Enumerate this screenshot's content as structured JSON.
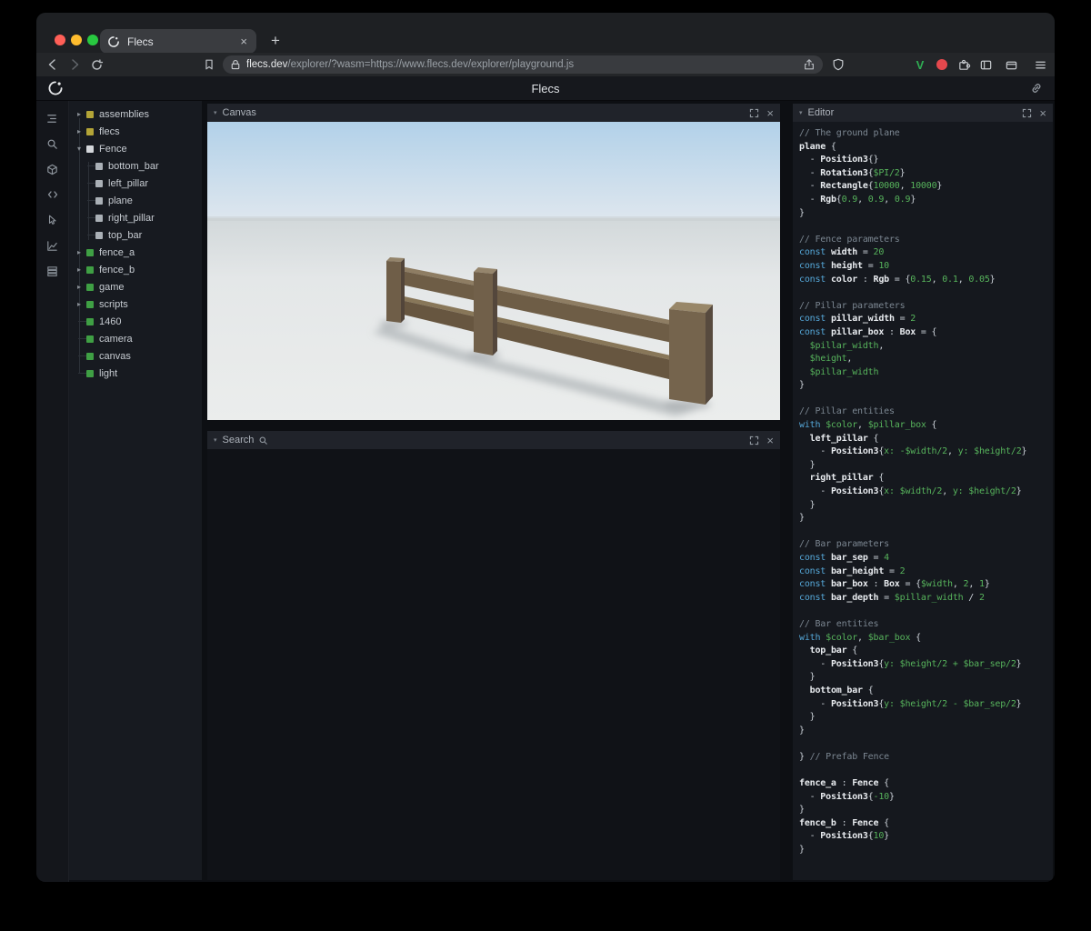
{
  "colors": {
    "module_yellow": "#b3a437",
    "prefab_white": "#d3d6da",
    "child_gray": "#aab0b6",
    "entity_green": "#3f9f44",
    "keyword_blue": "#55a7d8",
    "value_green": "#57b45c",
    "comment_gray": "#7b8691",
    "traffic_red": "#ff5f57",
    "traffic_yellow": "#febc2e",
    "traffic_green": "#28c840"
  },
  "browser": {
    "tab_title": "Flecs",
    "close_glyph": "×",
    "new_tab_glyph": "+",
    "url_host": "flecs.dev",
    "url_rest": "/explorer/?wasm=https://www.flecs.dev/explorer/playground.js"
  },
  "header": {
    "title": "Flecs"
  },
  "sidebar_icons": [
    "outliner-icon",
    "search-icon",
    "cube-icon",
    "code-icon",
    "inspect-icon",
    "chart-icon",
    "memory-icon"
  ],
  "tree": {
    "expanded_glyph": "▾",
    "collapsed_glyph": "▸",
    "items": [
      {
        "label": "assemblies",
        "swatch": "#b3a437",
        "expand": "right",
        "depth": 0
      },
      {
        "label": "flecs",
        "swatch": "#b3a437",
        "expand": "right",
        "depth": 0
      },
      {
        "label": "Fence",
        "swatch": "#d3d6da",
        "expand": "down",
        "depth": 0
      },
      {
        "label": "bottom_bar",
        "swatch": "#aab0b6",
        "expand": null,
        "depth": 1
      },
      {
        "label": "left_pillar",
        "swatch": "#aab0b6",
        "expand": null,
        "depth": 1
      },
      {
        "label": "plane",
        "swatch": "#aab0b6",
        "expand": null,
        "depth": 1
      },
      {
        "label": "right_pillar",
        "swatch": "#aab0b6",
        "expand": null,
        "depth": 1
      },
      {
        "label": "top_bar",
        "swatch": "#aab0b6",
        "expand": null,
        "depth": 1
      },
      {
        "label": "fence_a",
        "swatch": "#3f9f44",
        "expand": "right",
        "depth": 0
      },
      {
        "label": "fence_b",
        "swatch": "#3f9f44",
        "expand": "right",
        "depth": 0
      },
      {
        "label": "game",
        "swatch": "#3f9f44",
        "expand": "right",
        "depth": 0
      },
      {
        "label": "scripts",
        "swatch": "#3f9f44",
        "expand": "right",
        "depth": 0
      },
      {
        "label": "1460",
        "swatch": "#3f9f44",
        "expand": null,
        "depth": 0
      },
      {
        "label": "camera",
        "swatch": "#3f9f44",
        "expand": null,
        "depth": 0
      },
      {
        "label": "canvas",
        "swatch": "#3f9f44",
        "expand": null,
        "depth": 0
      },
      {
        "label": "light",
        "swatch": "#3f9f44",
        "expand": null,
        "depth": 0
      }
    ]
  },
  "panels": {
    "chevron_glyph": "▾",
    "close_glyph": "×",
    "canvas_title": "Canvas",
    "search_title": "Search",
    "editor_title": "Editor"
  },
  "editor": {
    "lines": [
      [
        [
          "c",
          "// The ground plane"
        ]
      ],
      [
        [
          "b",
          "plane"
        ],
        [
          "p",
          " {"
        ]
      ],
      [
        [
          "p",
          "  - "
        ],
        [
          "b",
          "Position3"
        ],
        [
          "p",
          "{}"
        ]
      ],
      [
        [
          "p",
          "  - "
        ],
        [
          "b",
          "Rotation3"
        ],
        [
          "p",
          "{"
        ],
        [
          "g",
          "$PI/2"
        ],
        [
          "p",
          "}"
        ]
      ],
      [
        [
          "p",
          "  - "
        ],
        [
          "b",
          "Rectangle"
        ],
        [
          "p",
          "{"
        ],
        [
          "g",
          "10000"
        ],
        [
          "p",
          ", "
        ],
        [
          "g",
          "10000"
        ],
        [
          "p",
          "}"
        ]
      ],
      [
        [
          "p",
          "  - "
        ],
        [
          "b",
          "Rgb"
        ],
        [
          "p",
          "{"
        ],
        [
          "g",
          "0.9"
        ],
        [
          "p",
          ", "
        ],
        [
          "g",
          "0.9"
        ],
        [
          "p",
          ", "
        ],
        [
          "g",
          "0.9"
        ],
        [
          "p",
          "}"
        ]
      ],
      [
        [
          "p",
          "}"
        ]
      ],
      [],
      [
        [
          "c",
          "// Fence parameters"
        ]
      ],
      [
        [
          "k",
          "const "
        ],
        [
          "b",
          "width"
        ],
        [
          "p",
          " = "
        ],
        [
          "g",
          "20"
        ]
      ],
      [
        [
          "k",
          "const "
        ],
        [
          "b",
          "height"
        ],
        [
          "p",
          " = "
        ],
        [
          "g",
          "10"
        ]
      ],
      [
        [
          "k",
          "const "
        ],
        [
          "b",
          "color"
        ],
        [
          "p",
          " : "
        ],
        [
          "b",
          "Rgb"
        ],
        [
          "p",
          " = {"
        ],
        [
          "g",
          "0.15"
        ],
        [
          "p",
          ", "
        ],
        [
          "g",
          "0.1"
        ],
        [
          "p",
          ", "
        ],
        [
          "g",
          "0.05"
        ],
        [
          "p",
          "}"
        ]
      ],
      [],
      [
        [
          "c",
          "// Pillar parameters"
        ]
      ],
      [
        [
          "k",
          "const "
        ],
        [
          "b",
          "pillar_width"
        ],
        [
          "p",
          " = "
        ],
        [
          "g",
          "2"
        ]
      ],
      [
        [
          "k",
          "const "
        ],
        [
          "b",
          "pillar_box"
        ],
        [
          "p",
          " : "
        ],
        [
          "b",
          "Box"
        ],
        [
          "p",
          " = {"
        ]
      ],
      [
        [
          "p",
          "  "
        ],
        [
          "g",
          "$pillar_width"
        ],
        [
          "p",
          ","
        ]
      ],
      [
        [
          "p",
          "  "
        ],
        [
          "g",
          "$height"
        ],
        [
          "p",
          ","
        ]
      ],
      [
        [
          "p",
          "  "
        ],
        [
          "g",
          "$pillar_width"
        ]
      ],
      [
        [
          "p",
          "}"
        ]
      ],
      [],
      [
        [
          "c",
          "// Pillar entities"
        ]
      ],
      [
        [
          "k",
          "with "
        ],
        [
          "g",
          "$color"
        ],
        [
          "p",
          ", "
        ],
        [
          "g",
          "$pillar_box"
        ],
        [
          "p",
          " {"
        ]
      ],
      [
        [
          "p",
          "  "
        ],
        [
          "b",
          "left_pillar"
        ],
        [
          "p",
          " {"
        ]
      ],
      [
        [
          "p",
          "    - "
        ],
        [
          "b",
          "Position3"
        ],
        [
          "p",
          "{"
        ],
        [
          "g",
          "x: -$width/2"
        ],
        [
          "p",
          ", "
        ],
        [
          "g",
          "y: $height/2"
        ],
        [
          "p",
          "}"
        ]
      ],
      [
        [
          "p",
          "  }"
        ]
      ],
      [
        [
          "p",
          "  "
        ],
        [
          "b",
          "right_pillar"
        ],
        [
          "p",
          " {"
        ]
      ],
      [
        [
          "p",
          "    - "
        ],
        [
          "b",
          "Position3"
        ],
        [
          "p",
          "{"
        ],
        [
          "g",
          "x: $width/2"
        ],
        [
          "p",
          ", "
        ],
        [
          "g",
          "y: $height/2"
        ],
        [
          "p",
          "}"
        ]
      ],
      [
        [
          "p",
          "  }"
        ]
      ],
      [
        [
          "p",
          "}"
        ]
      ],
      [],
      [
        [
          "c",
          "// Bar parameters"
        ]
      ],
      [
        [
          "k",
          "const "
        ],
        [
          "b",
          "bar_sep"
        ],
        [
          "p",
          " = "
        ],
        [
          "g",
          "4"
        ]
      ],
      [
        [
          "k",
          "const "
        ],
        [
          "b",
          "bar_height"
        ],
        [
          "p",
          " = "
        ],
        [
          "g",
          "2"
        ]
      ],
      [
        [
          "k",
          "const "
        ],
        [
          "b",
          "bar_box"
        ],
        [
          "p",
          " : "
        ],
        [
          "b",
          "Box"
        ],
        [
          "p",
          " = {"
        ],
        [
          "g",
          "$width"
        ],
        [
          "p",
          ", "
        ],
        [
          "g",
          "2"
        ],
        [
          "p",
          ", "
        ],
        [
          "g",
          "1"
        ],
        [
          "p",
          "}"
        ]
      ],
      [
        [
          "k",
          "const "
        ],
        [
          "b",
          "bar_depth"
        ],
        [
          "p",
          " = "
        ],
        [
          "g",
          "$pillar_width"
        ],
        [
          "p",
          " / "
        ],
        [
          "g",
          "2"
        ]
      ],
      [],
      [
        [
          "c",
          "// Bar entities"
        ]
      ],
      [
        [
          "k",
          "with "
        ],
        [
          "g",
          "$color"
        ],
        [
          "p",
          ", "
        ],
        [
          "g",
          "$bar_box"
        ],
        [
          "p",
          " {"
        ]
      ],
      [
        [
          "p",
          "  "
        ],
        [
          "b",
          "top_bar"
        ],
        [
          "p",
          " {"
        ]
      ],
      [
        [
          "p",
          "    - "
        ],
        [
          "b",
          "Position3"
        ],
        [
          "p",
          "{"
        ],
        [
          "g",
          "y: $height/2 + $bar_sep/2"
        ],
        [
          "p",
          "}"
        ]
      ],
      [
        [
          "p",
          "  }"
        ]
      ],
      [
        [
          "p",
          "  "
        ],
        [
          "b",
          "bottom_bar"
        ],
        [
          "p",
          " {"
        ]
      ],
      [
        [
          "p",
          "    - "
        ],
        [
          "b",
          "Position3"
        ],
        [
          "p",
          "{"
        ],
        [
          "g",
          "y: $height/2 - $bar_sep/2"
        ],
        [
          "p",
          "}"
        ]
      ],
      [
        [
          "p",
          "  }"
        ]
      ],
      [
        [
          "p",
          "}"
        ]
      ],
      [],
      [
        [
          "p",
          "} "
        ],
        [
          "c",
          "// Prefab Fence"
        ]
      ],
      [],
      [
        [
          "b",
          "fence_a"
        ],
        [
          "p",
          " : "
        ],
        [
          "b",
          "Fence"
        ],
        [
          "p",
          " {"
        ]
      ],
      [
        [
          "p",
          "  - "
        ],
        [
          "b",
          "Position3"
        ],
        [
          "p",
          "{"
        ],
        [
          "g",
          "-10"
        ],
        [
          "p",
          "}"
        ]
      ],
      [
        [
          "p",
          "}"
        ]
      ],
      [
        [
          "b",
          "fence_b"
        ],
        [
          "p",
          " : "
        ],
        [
          "b",
          "Fence"
        ],
        [
          "p",
          " {"
        ]
      ],
      [
        [
          "p",
          "  - "
        ],
        [
          "b",
          "Position3"
        ],
        [
          "p",
          "{"
        ],
        [
          "g",
          "10"
        ],
        [
          "p",
          "}"
        ]
      ],
      [
        [
          "p",
          "}"
        ]
      ]
    ]
  }
}
